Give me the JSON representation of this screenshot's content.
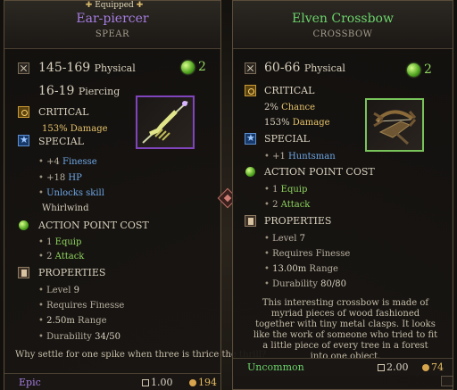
{
  "left_item": {
    "equipped_label": "Equipped",
    "name": "Ear-piercer",
    "type": "SPEAR",
    "damage_physical": "145-169",
    "damage_physical_type": "Physical",
    "damage_piercing": "16-19",
    "damage_piercing_type": "Piercing",
    "ap_value": "2",
    "critical_label": "CRITICAL",
    "critical_damage": "153%",
    "critical_damage_label": "Damage",
    "special_label": "SPECIAL",
    "special_1_value": "+4",
    "special_1_label": "Finesse",
    "special_2_value": "+18",
    "special_2_label": "HP",
    "special_3_label": "Unlocks skill",
    "special_3_value": "Whirlwind",
    "action_point_cost_label": "ACTION POINT COST",
    "equip_value": "1",
    "equip_label": "Equip",
    "attack_value": "2",
    "attack_label": "Attack",
    "properties_label": "PROPERTIES",
    "level_label": "Level",
    "level_value": "9",
    "requires_label": "Requires Finesse",
    "range_value": "2.50m",
    "range_label": "Range",
    "durability_label": "Durability",
    "durability_value": "34/50",
    "flavor": "Why settle for one spike when three is thrice the thrill?",
    "rarity": "Epic",
    "weight": "1.00",
    "value": "194"
  },
  "right_item": {
    "name": "Elven Crossbow",
    "type": "CROSSBOW",
    "damage_physical": "60-66",
    "damage_physical_type": "Physical",
    "ap_value": "2",
    "critical_label": "CRITICAL",
    "critical_chance": "2%",
    "critical_chance_label": "Chance",
    "critical_damage": "153%",
    "critical_damage_label": "Damage",
    "special_label": "SPECIAL",
    "special_1_value": "+1",
    "special_1_label": "Huntsman",
    "action_point_cost_label": "ACTION POINT COST",
    "equip_value": "1",
    "equip_label": "Equip",
    "attack_value": "2",
    "attack_label": "Attack",
    "properties_label": "PROPERTIES",
    "level_label": "Level",
    "level_value": "7",
    "requires_label": "Requires Finesse",
    "range_value": "13.00m",
    "range_label": "Range",
    "durability_label": "Durability",
    "durability_value": "80/80",
    "description": "This interesting crossbow is made of myriad pieces of wood fashioned together with tiny metal clasps. It looks like the work of someone who tried to fit a little piece of every tree in a forest into one object.",
    "rarity": "Uncommon",
    "weight": "2.00",
    "value": "74"
  },
  "colors": {
    "epic": "#a57de2",
    "uncommon": "#6bd46b",
    "gold": "#e8c56c",
    "blue": "#6fa7e6",
    "green": "#8fd45f"
  },
  "icons": {
    "sword": "sword-icon",
    "critical": "critical-icon",
    "special": "star-icon",
    "ap": "action-point-icon",
    "properties": "properties-icon",
    "compare": "compare-arrow-icon"
  }
}
